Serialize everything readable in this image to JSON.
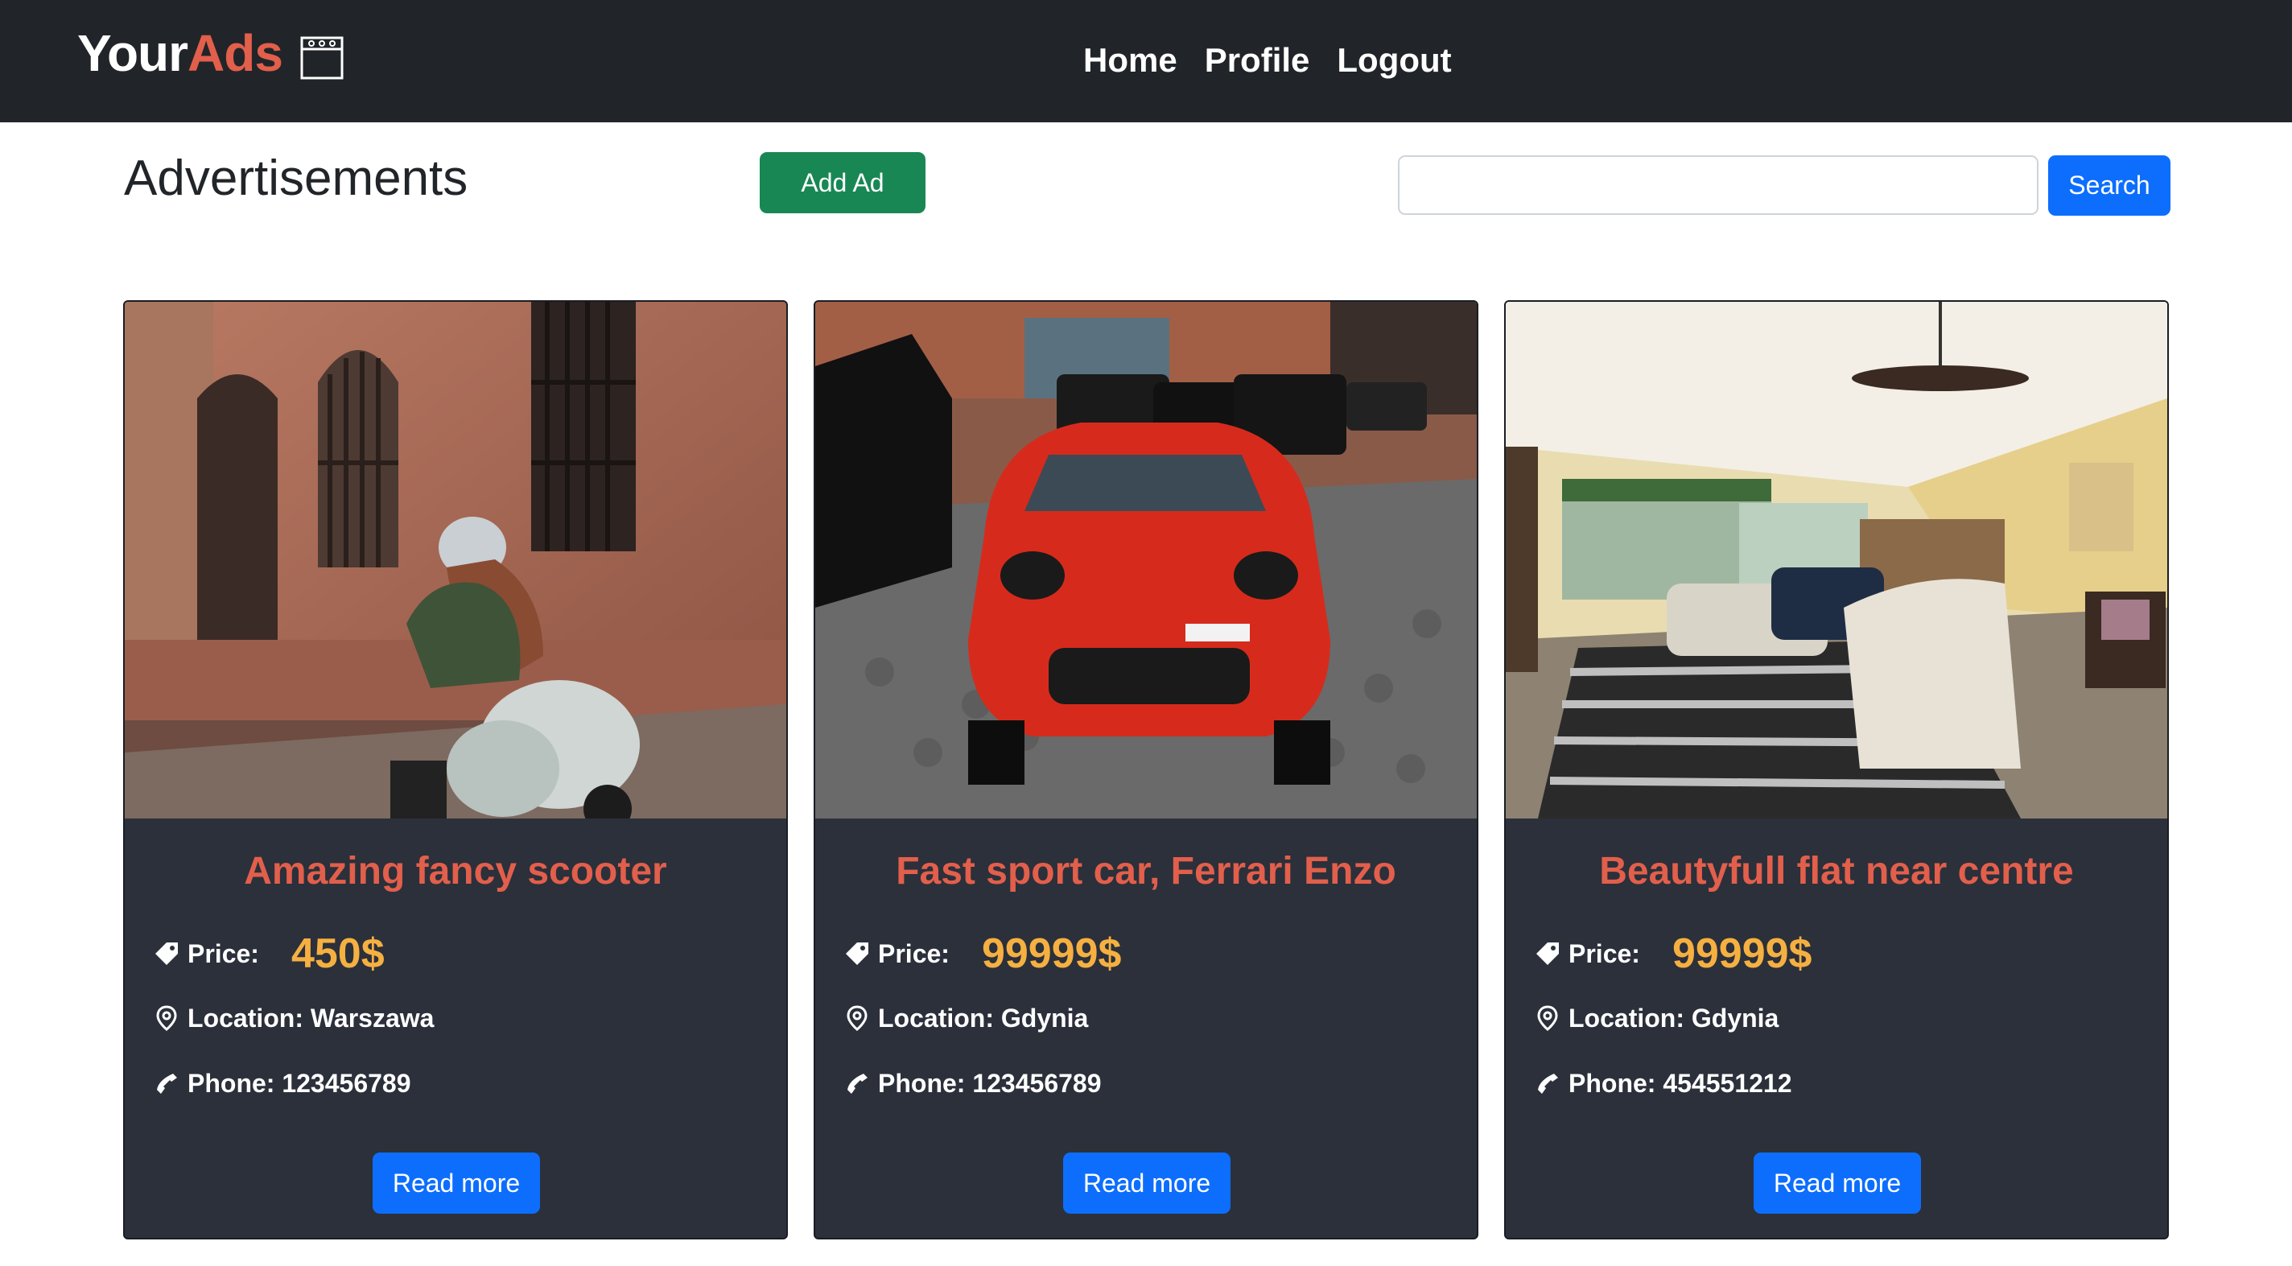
{
  "navbar": {
    "brand_part1": "Your",
    "brand_part2": "Ads",
    "brand_icon": "calendar-icon",
    "links": [
      "Home",
      "Profile",
      "Logout"
    ]
  },
  "header": {
    "title": "Advertisements",
    "add_button": "Add Ad",
    "search_value": "",
    "search_button": "Search"
  },
  "colors": {
    "navbar_bg": "#212529",
    "accent": "#e25f4b",
    "price": "#f5b041",
    "card_bg": "#2b303b",
    "primary_button": "#0d6efd",
    "success_button": "#198754"
  },
  "ads": [
    {
      "title": "Amazing fancy scooter",
      "price_label": "Price:",
      "price": "450$",
      "location": "Location: Warszawa",
      "phone": "Phone: 123456789",
      "button": "Read more",
      "image": "scooter-photo"
    },
    {
      "title": "Fast sport car, Ferrari Enzo",
      "price_label": "Price:",
      "price": "99999$",
      "location": "Location: Gdynia",
      "phone": "Phone: 123456789",
      "button": "Read more",
      "image": "sports-car-photo"
    },
    {
      "title": "Beautyfull flat near centre",
      "price_label": "Price:",
      "price": "99999$",
      "location": "Location: Gdynia",
      "phone": "Phone: 454551212",
      "button": "Read more",
      "image": "living-room-photo"
    }
  ]
}
